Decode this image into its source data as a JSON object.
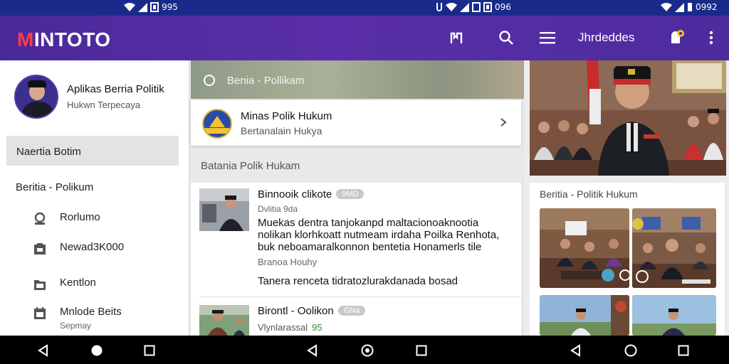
{
  "status_bar": {
    "left_time": "995",
    "mid_time": "096",
    "right_time": "0992"
  },
  "app_bar": {
    "logo_accent": "M",
    "logo_rest": "INTOTO",
    "label": "Jhrdeddes",
    "accent_color": "#ff3b4a",
    "background_color": "#4f2ca0",
    "icons": [
      "bookmark-flag-icon",
      "search-icon",
      "menu-icon",
      "notification-icon",
      "more-vert-icon"
    ]
  },
  "drawer": {
    "profile_title": "Aplikas Berria Politik",
    "profile_subtitle": "Hukwn Terpecaya",
    "active_item": "Naertia Botim",
    "section_label": "Beritia - Polikum",
    "items": [
      {
        "label": "Rorlumo",
        "sub": "",
        "icon": "location-icon"
      },
      {
        "label": "Newad3K000",
        "sub": "",
        "icon": "document-icon"
      },
      {
        "label": "Kentlon",
        "sub": "",
        "icon": "folder-icon"
      },
      {
        "label": "Mnlode Beits",
        "sub": "Sepmay",
        "icon": "calendar-icon"
      }
    ]
  },
  "middle": {
    "banner_title": "Benia - Pollikam",
    "featured": {
      "title": "Minas Polik Hukum",
      "subtitle": "Bertanalain Hukya"
    },
    "section_label": "Batania Polik Hukam",
    "news": [
      {
        "title": "Binnooik clikote",
        "badge": "9MD",
        "meta": "Dvlitia 9da",
        "body": "Muekas dentra tanjokanpd maltacionoaknootia nolikan klorhkoatt nutmeam irdaha Poilka Renhota, buk neboamaralkonnon bentetia Honamerls tile",
        "source": "Branoa Houhy",
        "footer": "Tanera renceta tidratozlurakdanada bosad"
      },
      {
        "title": "Birontl - Oolikon",
        "badge": "GNa",
        "date": "Vlynlarassal",
        "date_accent": "95"
      }
    ]
  },
  "right": {
    "gallery_title": "Beritia - Politik Hukum"
  }
}
